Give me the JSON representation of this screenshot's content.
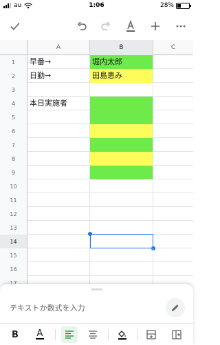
{
  "status_bar": {
    "carrier": "au",
    "time": "1:06",
    "battery": "28%",
    "battery_level": 0.28
  },
  "toolbar": {
    "done_icon": "check-icon",
    "undo_icon": "undo-icon",
    "redo_icon": "redo-icon",
    "text_color_icon": "text-format-icon",
    "add_icon": "add-icon",
    "more_icon": "more-horiz-icon"
  },
  "columns": [
    "A",
    "B",
    "C"
  ],
  "selected_column": "B",
  "rows": [
    {
      "num": "1",
      "a": "早番→",
      "b": "堀内太郎",
      "b_fill": "green"
    },
    {
      "num": "2",
      "a": "日勤→",
      "b": "田島恵み",
      "b_fill": "yellow"
    },
    {
      "num": "3",
      "a": "",
      "b": "",
      "b_fill": "none"
    },
    {
      "num": "4",
      "a": "本日実施者",
      "b": "",
      "b_fill": "green"
    },
    {
      "num": "5",
      "a": "",
      "b": "",
      "b_fill": "green"
    },
    {
      "num": "6",
      "a": "",
      "b": "",
      "b_fill": "yellow"
    },
    {
      "num": "7",
      "a": "",
      "b": "",
      "b_fill": "green"
    },
    {
      "num": "8",
      "a": "",
      "b": "",
      "b_fill": "yellow"
    },
    {
      "num": "9",
      "a": "",
      "b": "",
      "b_fill": "green"
    },
    {
      "num": "10",
      "a": "",
      "b": "",
      "b_fill": "none"
    },
    {
      "num": "11",
      "a": "",
      "b": "",
      "b_fill": "none"
    },
    {
      "num": "12",
      "a": "",
      "b": "",
      "b_fill": "none"
    },
    {
      "num": "13",
      "a": "",
      "b": "",
      "b_fill": "none"
    },
    {
      "num": "14",
      "a": "",
      "b": "",
      "b_fill": "none"
    },
    {
      "num": "15",
      "a": "",
      "b": "",
      "b_fill": "none"
    },
    {
      "num": "16",
      "a": "",
      "b": "",
      "b_fill": "none"
    },
    {
      "num": "17",
      "a": "",
      "b": "",
      "b_fill": "none"
    },
    {
      "num": "18",
      "a": "",
      "b": "",
      "b_fill": "none"
    }
  ],
  "selected_cell": "B14",
  "colors": {
    "green": "#6eeb4a",
    "yellow": "#fcfc5a",
    "selection": "#1a73e8",
    "align_active_bg": "#e6f4ea"
  },
  "formula_bar": {
    "placeholder": "テキストか数式を入力",
    "edit_icon": "pencil-icon"
  },
  "format_bar": {
    "bold": "B",
    "text_color": "A",
    "align_left_icon": "align-left-icon",
    "align_center_icon": "align-center-icon",
    "fill_color_icon": "fill-color-icon",
    "insert_row_icon": "insert-row-icon",
    "insert_col_icon": "insert-column-icon"
  }
}
